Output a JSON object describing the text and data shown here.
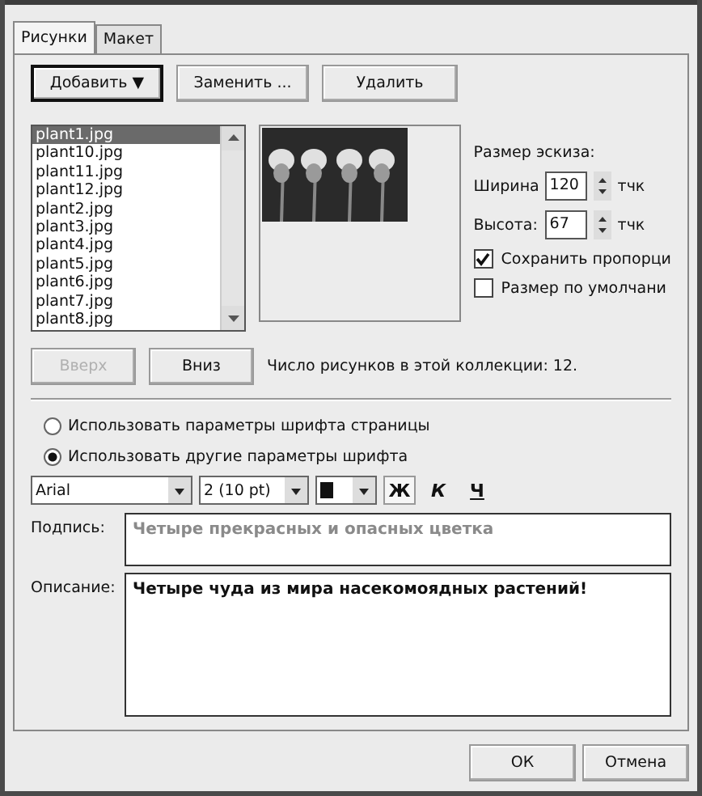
{
  "tabs": [
    {
      "label": "Рисунки",
      "selected": true
    },
    {
      "label": "Макет",
      "selected": false
    }
  ],
  "actions": [
    {
      "label": "Добавить",
      "caret": "▼",
      "focused": true
    },
    {
      "label": "Заменить ...",
      "focused": false
    },
    {
      "label": "Удалить",
      "focused": false
    }
  ],
  "files": [
    {
      "name": "plant1.jpg",
      "selected": true
    },
    {
      "name": "plant10.jpg",
      "selected": false
    },
    {
      "name": "plant11.jpg",
      "selected": false
    },
    {
      "name": "plant12.jpg",
      "selected": false
    },
    {
      "name": "plant2.jpg",
      "selected": false
    },
    {
      "name": "plant3.jpg",
      "selected": false
    },
    {
      "name": "plant4.jpg",
      "selected": false
    },
    {
      "name": "plant5.jpg",
      "selected": false
    },
    {
      "name": "plant6.jpg",
      "selected": false
    },
    {
      "name": "plant7.jpg",
      "selected": false
    },
    {
      "name": "plant8.jpg",
      "selected": false
    }
  ],
  "preview": {
    "kind": "picture"
  },
  "thumb_size": {
    "title": "Размер эскиза:",
    "fields": [
      {
        "label": "Ширина",
        "value": "120",
        "unit": "тчк"
      },
      {
        "label": "Высота:",
        "value": "67",
        "unit": "тчк"
      }
    ],
    "checks": [
      {
        "label": "Сохранить пропорци",
        "checked": true
      },
      {
        "label": "Размер по умолчани",
        "checked": false
      }
    ]
  },
  "order_buttons": [
    {
      "label": "Вверх",
      "disabled": true
    },
    {
      "label": "Вниз",
      "disabled": false
    }
  ],
  "count_text": "Число рисунков в этой коллекции: 12.",
  "font_options": [
    {
      "label": "Использовать параметры шрифта страницы",
      "selected": false
    },
    {
      "label": "Использовать другие параметры шрифта",
      "selected": true
    }
  ],
  "font": {
    "family": "Arial",
    "size": "2 (10 pt)",
    "styles": [
      {
        "label": "Ж",
        "kind": "bold",
        "pressed": true
      },
      {
        "label": "К",
        "kind": "italic",
        "pressed": false
      },
      {
        "label": "Ч",
        "kind": "underline",
        "pressed": false
      }
    ]
  },
  "caption": {
    "label": "Подпись:",
    "value": "Четыре прекрасных и опасных цветка"
  },
  "description": {
    "label": "Описание:",
    "value": "Четыре чуда из мира насекомоядных растений!"
  },
  "buttons": [
    "ОК",
    "Отмена"
  ]
}
